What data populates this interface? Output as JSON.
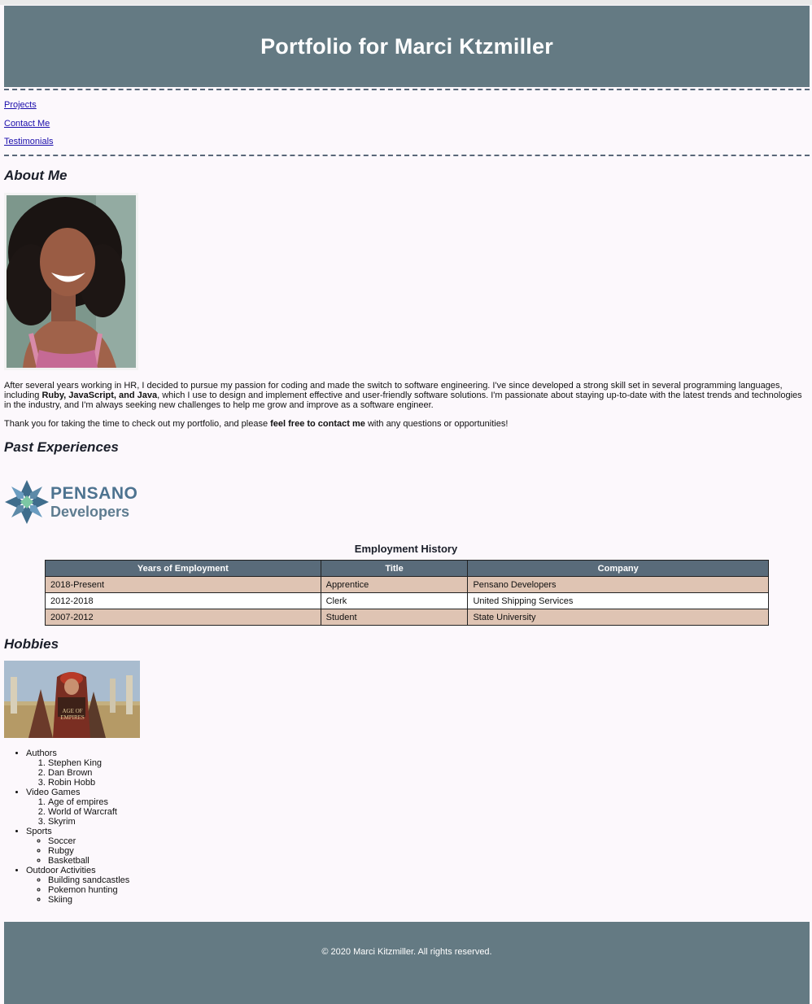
{
  "header": {
    "title": "Portfolio for Marci Ktzmiller"
  },
  "nav": {
    "items": [
      "Projects",
      "Contact Me",
      "Testimonials"
    ]
  },
  "about": {
    "heading": "About Me",
    "para1_a": "After several years working in HR, I decided to pursue my passion for coding and made the switch to software engineering. I've since developed a strong skill set in several programming languages, including ",
    "para1_bold": "Ruby, JavaScript, and Java",
    "para1_b": ", which I use to design and implement effective and user-friendly software solutions. I'm passionate about staying up-to-date with the latest trends and technologies in the industry, and I'm always seeking new challenges to help me grow and improve as a software engineer.",
    "para2_a": "Thank you for taking the time to check out my portfolio, and please ",
    "para2_bold": "feel free to contact me",
    "para2_b": " with any questions or opportunities!"
  },
  "experience": {
    "heading": "Past Experiences",
    "logo_line1": "PENSANO",
    "logo_line2": "Developers",
    "table_caption": "Employment History",
    "columns": [
      "Years of Employment",
      "Title",
      "Company"
    ],
    "rows": [
      [
        "2018-Present",
        "Apprentice",
        "Pensano Developers"
      ],
      [
        "2012-2018",
        "Clerk",
        "United Shipping Services"
      ],
      [
        "2007-2012",
        "Student",
        "State University"
      ]
    ]
  },
  "hobbies": {
    "heading": "Hobbies",
    "image_text": "AGE OF EMPIRES",
    "groups": [
      {
        "label": "Authors",
        "ordered": true,
        "items": [
          "Stephen King",
          "Dan Brown",
          "Robin Hobb"
        ]
      },
      {
        "label": "Video Games",
        "ordered": true,
        "items": [
          "Age of empires",
          "World of Warcraft",
          "Skyrim"
        ]
      },
      {
        "label": "Sports",
        "ordered": false,
        "items": [
          "Soccer",
          "Rubgy",
          "Basketball"
        ]
      },
      {
        "label": "Outdoor Activities",
        "ordered": false,
        "items": [
          "Building sandcastles",
          "Pokemon hunting",
          "Skiing"
        ]
      }
    ]
  },
  "footer": {
    "text": "© 2020 Marci Kitzmiller. All rights reserved."
  },
  "colors": {
    "header_bg": "#647a83",
    "table_header": "#596b7a",
    "row_tint": "#dfc4b3",
    "page_bg": "#fcf8fc"
  }
}
